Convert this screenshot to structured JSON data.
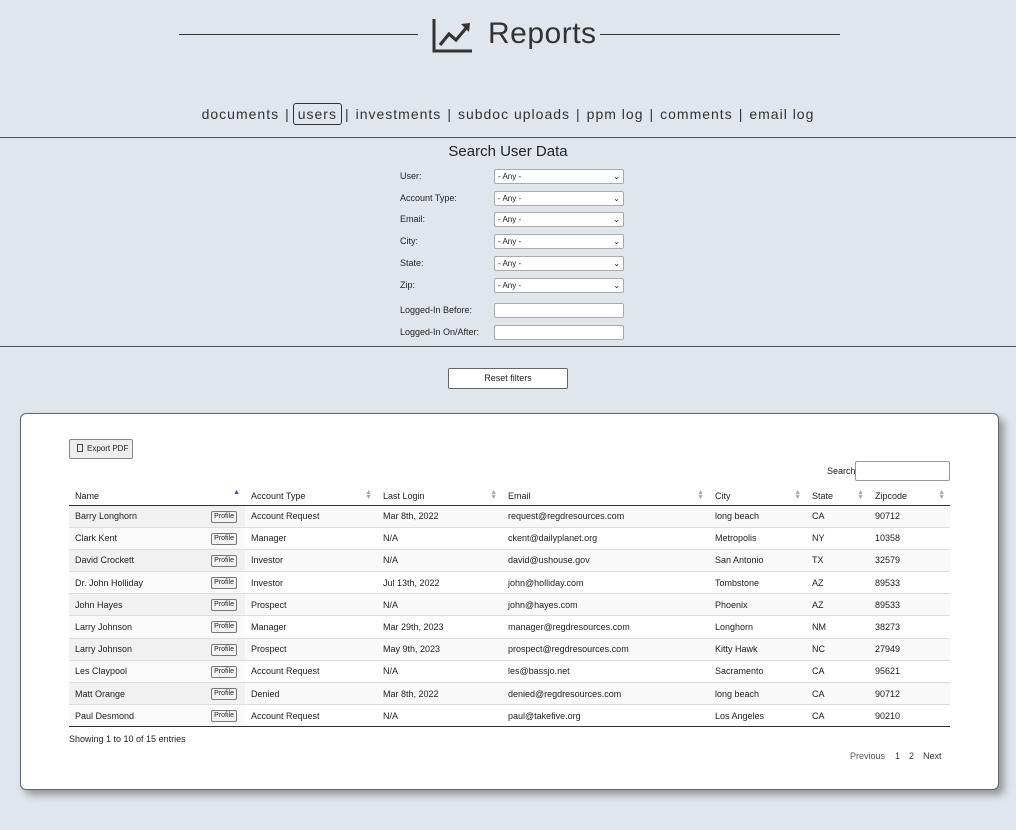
{
  "header": {
    "title": "Reports",
    "icon": "chart-line-icon"
  },
  "nav": {
    "items": [
      {
        "label": "documents"
      },
      {
        "label": "users"
      },
      {
        "label": "investments"
      },
      {
        "label": "subdoc uploads"
      },
      {
        "label": "ppm log"
      },
      {
        "label": "comments"
      },
      {
        "label": "email log"
      }
    ],
    "active": "users",
    "separator": "|"
  },
  "filters": {
    "title": "Search User Data",
    "user": {
      "label": "User:",
      "value": "- Any -"
    },
    "account_type": {
      "label": "Account Type:",
      "value": "- Any -"
    },
    "email": {
      "label": "Email:",
      "value": "- Any -"
    },
    "city": {
      "label": "City:",
      "value": "- Any -"
    },
    "state": {
      "label": "State:",
      "value": "- Any -"
    },
    "zip": {
      "label": "Zip:",
      "value": "- Any -"
    },
    "logged_before": {
      "label": "Logged-In Before:",
      "value": ""
    },
    "logged_after": {
      "label": "Logged-In On/After:",
      "value": ""
    },
    "reset_label": "Reset filters"
  },
  "table": {
    "export_label": "Export PDF",
    "search_label": "Search:",
    "search_value": "",
    "profile_label": "Profile",
    "columns": [
      "Name",
      "Account Type",
      "Last Login",
      "Email",
      "City",
      "State",
      "Zipcode"
    ],
    "rows": [
      [
        "Barry Longhorn",
        "Account Request",
        "Mar 8th, 2022",
        "request@regdresources.com",
        "long beach",
        "CA",
        "90712"
      ],
      [
        "Clark Kent",
        "Manager",
        "N/A",
        "ckent@dailyplanet.org",
        "Metropolis",
        "NY",
        "10358"
      ],
      [
        "David Crockett",
        "Investor",
        "N/A",
        "david@ushouse.gov",
        "San Antonio",
        "TX",
        "32579"
      ],
      [
        "Dr. John Holliday",
        "Investor",
        "Jul 13th, 2022",
        "john@holliday.com",
        "Tombstone",
        "AZ",
        "89533"
      ],
      [
        "John Hayes",
        "Prospect",
        "N/A",
        "john@hayes.com",
        "Phoenix",
        "AZ",
        "89533"
      ],
      [
        "Larry Johnson",
        "Manager",
        "Mar 29th, 2023",
        "manager@regdresources.com",
        "Longhorn",
        "NM",
        "38273"
      ],
      [
        "Larry Johnson",
        "Prospect",
        "May 9th, 2023",
        "prospect@regdresources.com",
        "Kitty Hawk",
        "NC",
        "27949"
      ],
      [
        "Les Claypool",
        "Account Request",
        "N/A",
        "les@bassjo.net",
        "Sacramento",
        "CA",
        "95621"
      ],
      [
        "Matt Orange",
        "Denied",
        "Mar 8th, 2022",
        "denied@regdresources.com",
        "long beach",
        "CA",
        "90712"
      ],
      [
        "Paul Desmond",
        "Account Request",
        "N/A",
        "paul@takefive.org",
        "Los Angeles",
        "CA",
        "90210"
      ]
    ],
    "info": "Showing 1 to 10 of 15 entries",
    "pager": {
      "prev": "Previous",
      "pages": [
        "1",
        "2"
      ],
      "next": "Next"
    }
  }
}
